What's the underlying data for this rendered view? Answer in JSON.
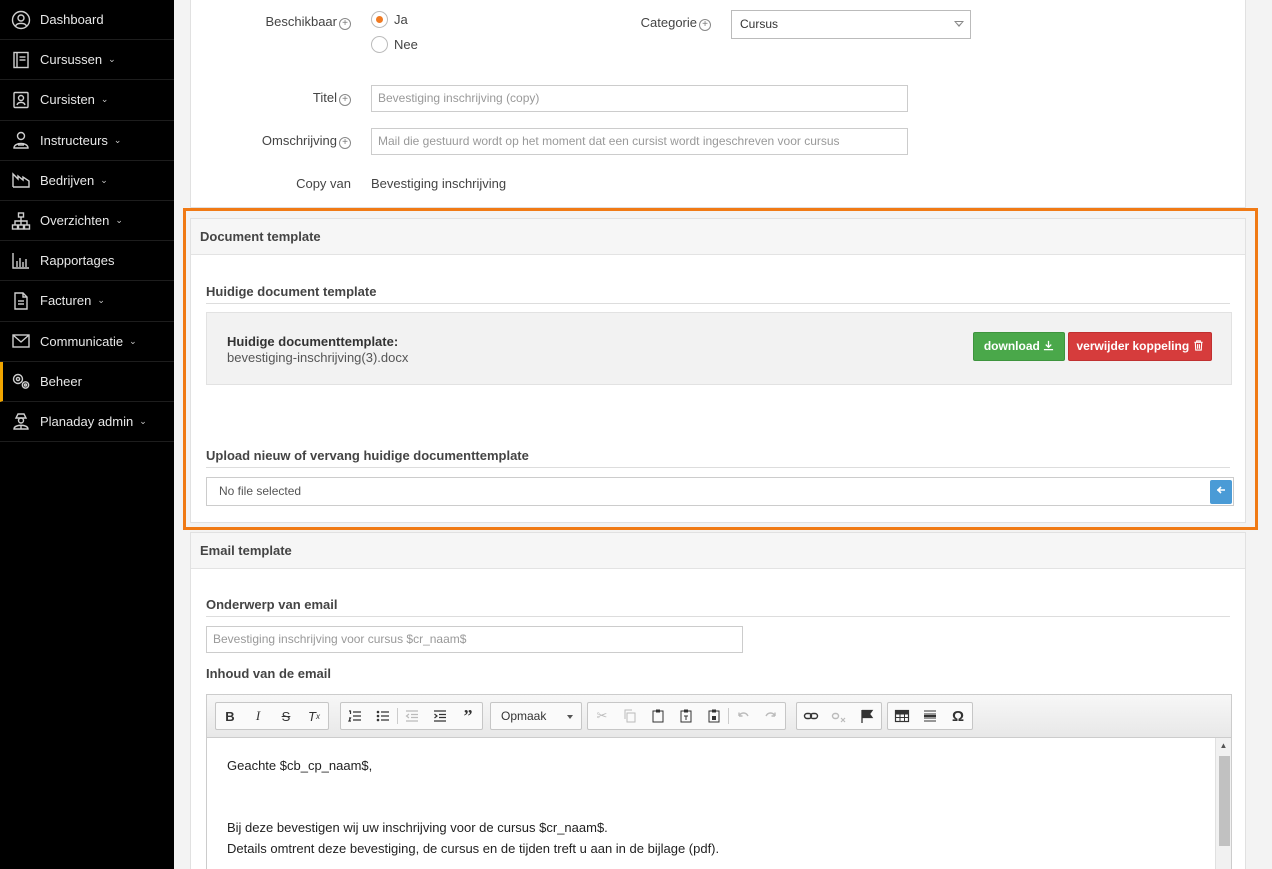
{
  "sidebar": {
    "items": [
      {
        "label": "Dashboard",
        "icon": "user-circle-icon",
        "caret": false
      },
      {
        "label": "Cursussen",
        "icon": "book-icon",
        "caret": true
      },
      {
        "label": "Cursisten",
        "icon": "id-card-icon",
        "caret": true
      },
      {
        "label": "Instructeurs",
        "icon": "instructor-icon",
        "caret": true
      },
      {
        "label": "Bedrijven",
        "icon": "factory-icon",
        "caret": true
      },
      {
        "label": "Overzichten",
        "icon": "sitemap-icon",
        "caret": true
      },
      {
        "label": "Rapportages",
        "icon": "bar-chart-icon",
        "caret": false
      },
      {
        "label": "Facturen",
        "icon": "invoice-icon",
        "caret": true
      },
      {
        "label": "Communicatie",
        "icon": "envelope-icon",
        "caret": true
      },
      {
        "label": "Beheer",
        "icon": "gears-icon",
        "caret": false,
        "active": true
      },
      {
        "label": "Planaday admin",
        "icon": "admin-icon",
        "caret": true
      }
    ],
    "caret_glyph": "⌄"
  },
  "form": {
    "beschikbaar_label": "Beschikbaar",
    "radio_ja": "Ja",
    "radio_nee": "Nee",
    "categorie_label": "Categorie",
    "categorie_value": "Cursus",
    "titel_label": "Titel",
    "titel_placeholder": "Bevestiging inschrijving (copy)",
    "omschrijving_label": "Omschrijving",
    "omschrijving_placeholder": "Mail die gestuurd wordt op het moment dat een cursist wordt ingeschreven voor cursus",
    "copy_label": "Copy van",
    "copy_value": "Bevestiging inschrijving",
    "plus_glyph": "+"
  },
  "document_template": {
    "header": "Document template",
    "current_section_title": "Huidige document template",
    "current_label": "Huidige documenttemplate:",
    "current_file": "bevestiging-inschrijving(3).docx",
    "download_label": "download",
    "remove_label": "verwijder koppeling",
    "upload_section_title": "Upload nieuw of vervang huidige documenttemplate",
    "file_input_text": "No file selected"
  },
  "email_template": {
    "header": "Email template",
    "subject_title": "Onderwerp van email",
    "subject_placeholder": "Bevestiging inschrijving voor cursus $cr_naam$",
    "content_title": "Inhoud van de email",
    "format_combo": "Opmaak",
    "body_lines": [
      "Geachte $cb_cp_naam$,",
      "Bij deze bevestigen wij uw inschrijving voor de cursus $cr_naam$.",
      "Details omtrent deze bevestiging, de cursus en de tijden treft u aan in de bijlage (pdf)."
    ]
  },
  "colors": {
    "highlight": "#f07a15",
    "download_btn": "#4aa84a",
    "remove_btn": "#d63c3c",
    "radio_selected": "#f07a22"
  }
}
